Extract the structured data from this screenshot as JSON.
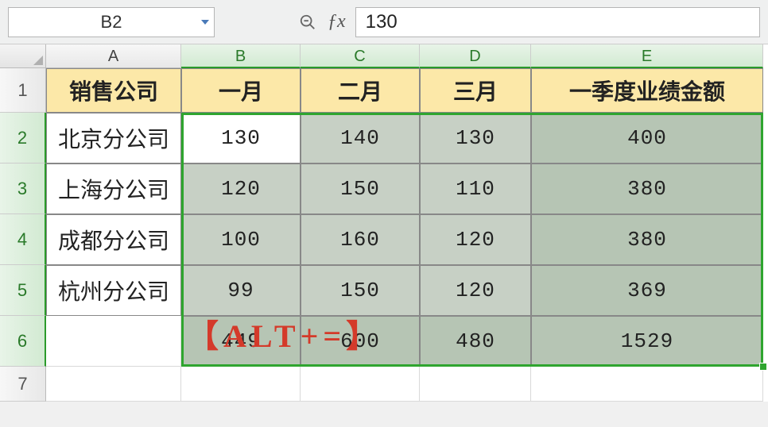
{
  "formula_bar": {
    "cell_reference": "B2",
    "formula_value": "130"
  },
  "columns": [
    "A",
    "B",
    "C",
    "D",
    "E"
  ],
  "rows": [
    "1",
    "2",
    "3",
    "4",
    "5",
    "6",
    "7"
  ],
  "headers": {
    "company": "销售公司",
    "jan": "一月",
    "feb": "二月",
    "mar": "三月",
    "q1": "一季度业绩金额"
  },
  "data_rows": [
    {
      "name": "北京分公司",
      "jan": "130",
      "feb": "140",
      "mar": "130",
      "q1": "400"
    },
    {
      "name": "上海分公司",
      "jan": "120",
      "feb": "150",
      "mar": "110",
      "q1": "380"
    },
    {
      "name": "成都分公司",
      "jan": "100",
      "feb": "160",
      "mar": "120",
      "q1": "380"
    },
    {
      "name": "杭州分公司",
      "jan": "99",
      "feb": "150",
      "mar": "120",
      "q1": "369"
    }
  ],
  "totals": {
    "jan": "449",
    "feb": "600",
    "mar": "480",
    "q1": "1529"
  },
  "overlay": "【ALT+=】",
  "chart_data": {
    "type": "table",
    "title": "一季度业绩金额",
    "columns": [
      "销售公司",
      "一月",
      "二月",
      "三月",
      "一季度业绩金额"
    ],
    "rows": [
      [
        "北京分公司",
        130,
        140,
        130,
        400
      ],
      [
        "上海分公司",
        120,
        150,
        110,
        380
      ],
      [
        "成都分公司",
        100,
        160,
        120,
        380
      ],
      [
        "杭州分公司",
        99,
        150,
        120,
        369
      ],
      [
        "",
        449,
        600,
        480,
        1529
      ]
    ]
  }
}
